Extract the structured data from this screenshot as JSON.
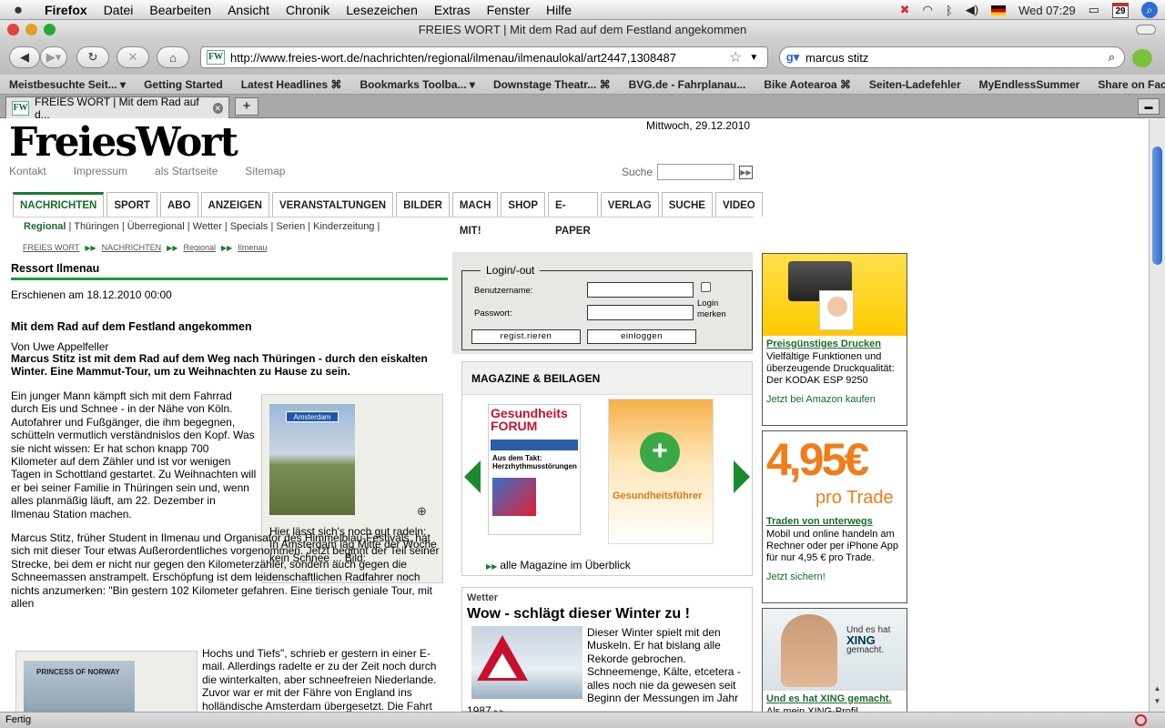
{
  "menubar": {
    "app": "Firefox",
    "items": [
      "Datei",
      "Bearbeiten",
      "Ansicht",
      "Chronik",
      "Lesezeichen",
      "Extras",
      "Fenster",
      "Hilfe"
    ],
    "clock": "Wed 07:29",
    "calendar_day": "29"
  },
  "window": {
    "title": "FREIES WORT | Mit dem Rad auf dem Festland angekommen"
  },
  "nav": {
    "url": "http://www.freies-wort.de/nachrichten/regional/ilmenau/ilmenaulokal/art2447,1308487",
    "favicon": "FW",
    "search_value": "marcus stitz"
  },
  "bookmarks": [
    "Meistbesuchte Seit... ▾",
    "Getting Started",
    "Latest Headlines ⌘",
    "Bookmarks Toolba... ▾",
    "Downstage Theatr... ⌘",
    "BVG.de - Fahrplanau...",
    "Bike Aotearoa ⌘",
    "Seiten-Ladefehler",
    "MyEndlessSummer",
    "Share on Facebook"
  ],
  "tab": {
    "label": "FREIES WORT | Mit dem Rad auf d..."
  },
  "status": {
    "text": "Fertig"
  },
  "page": {
    "logo": "FreiesWort",
    "date": "Mittwoch, 29.12.2010",
    "toplinks": [
      "Kontakt",
      "Impressum",
      "als Startseite",
      "Sitemap"
    ],
    "search_label": "Suche",
    "mainnav": [
      "NACHRICHTEN",
      "SPORT",
      "ABO",
      "ANZEIGEN",
      "VERANSTALTUNGEN",
      "BILDER",
      "MACH MIT!",
      "SHOP",
      "E-PAPER",
      "VERLAG",
      "SUCHE",
      "VIDEO"
    ],
    "subnav_active": "Regional",
    "subnav_rest": " | Thüringen | Überregional | Wetter | Specials | Serien | Kinderzeitung |",
    "breadcrumb": [
      "FREIES WORT",
      "NACHRICHTEN",
      "Regional",
      "Ilmenau"
    ],
    "ressort": "Ressort Ilmenau",
    "published": "Erschienen am 18.12.2010 00:00",
    "headline": "Mit dem Rad auf dem Festland angekommen",
    "author": "Von Uwe Appelfeller",
    "lead": "Marcus Stitz ist mit dem Rad auf dem Weg nach Thüringen - durch den eiskalten Winter. Eine Mammut-Tour, um zu Weihnachten zu Hause zu sein.",
    "body1": "Ein junger Mann kämpft sich mit dem Fahrrad durch Eis und Schnee - in der Nähe von Köln. Autofahrer und Fußgänger, die ihm begegnen, schütteln vermutlich verständnislos den Kopf. Was sie nicht wissen: Er hat schon knapp 700 Kilometer auf dem Zähler und ist vor wenigen Tagen in Schottland gestartet. Zu Weihnachten will er bei seiner Familie in Thüringen sein und, wenn alles planmäßig läuft, am 22. Dezember in Ilmenau Station machen.",
    "body2": "Marcus Stitz, früher Student in Ilmenau und Organisator des Himmelblau-Festivals, hat sich mit dieser Tour etwas Außerordentliches vorgenommen. Jetzt beginnt der Teil seiner Strecke, bei dem er nicht nur gegen den Kilometerzähler, sondern auch gegen die Schneemassen anstrampelt. Erschöpfung ist dem leidenschaftlichen Radfahrer noch nichts anzumerken: \"Bin gestern 102 Kilometer gefahren. Eine tierisch geniale Tour, mit allen",
    "body3": "Hochs und Tiefs\", schrieb er gestern in einer E-mail. Allerdings radelte er zu der Zeit noch durch die winterkalten, aber schneefreien Niederlande. Zuvor war er mit der Fähre von England ins holländische Amsterdam übergesetzt. Die Fahrt",
    "photo_sign": "Amsterdam",
    "caption": "Hier lässt sich's noch gut radeln: In Amsterdam lag Mitte der Woche kein Schnee ... Bild:",
    "photo2_text": "PRINCESS OF NORWAY",
    "login": {
      "legend": "Login/-out",
      "user_label": "Benutzername:",
      "pass_label": "Passwort:",
      "remember": "Login merken",
      "register": "regist.rieren",
      "login_btn": "einloggen"
    },
    "magazines": {
      "title": "MAGAZINE & BEILAGEN",
      "mag1_title": "Gesundheits FORUM",
      "mag1_sub": "Aus dem Takt: Herzrhythmusstörungen",
      "mag2_title": "Gesundheitsführer",
      "all": "alle Magazine im Überblick"
    },
    "wetter": {
      "label": "Wetter",
      "headline": "Wow - schlägt dieser Winter zu !",
      "text": "Dieser Winter spielt mit den Muskeln. Er hat bislang alle Rekorde gebrochen. Schneemenge, Kälte, etcetera - alles noch nie da gewesen seit Beginn der Messungen im Jahr",
      "more": "1987"
    },
    "ads": [
      {
        "link": "Preisgünstiges Drucken",
        "text": "Vielfältige Funktionen und überzeugende Druckqualität: Der KODAK ESP 9250",
        "cta": "Jetzt bei Amazon kaufen"
      },
      {
        "price": "4,95€",
        "sub": "pro Trade",
        "link": "Traden von unterwegs",
        "text": "Mobil und online handeln am Rechner oder per iPhone App für nur 4,95 € pro Trade.",
        "cta": "Jetzt sichern!"
      },
      {
        "logo_small": "Und es hat",
        "logo_big": "XING",
        "logo_tail": "gemacht.",
        "link": "Und es hat XING gemacht.",
        "text": "Als mein XING-Profil"
      }
    ]
  }
}
